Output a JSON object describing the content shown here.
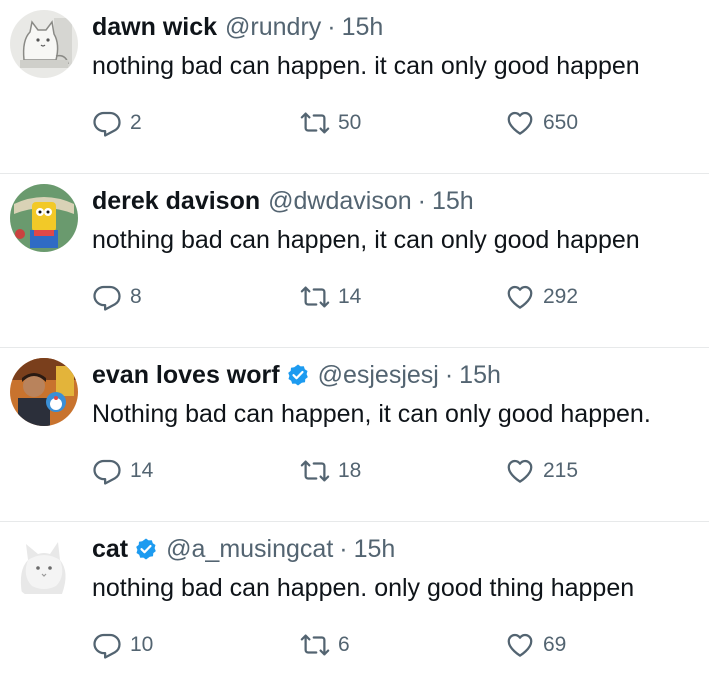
{
  "tweets": [
    {
      "name": "dawn wick",
      "handle": "@rundry",
      "time": "15h",
      "verified": false,
      "text": "nothing bad can happen. it can only good happen",
      "replies": "2",
      "retweets": "50",
      "likes": "650",
      "avatar": "cat-drawing-avatar"
    },
    {
      "name": "derek davison",
      "handle": "@dwdavison",
      "time": "15h",
      "verified": false,
      "text": "nothing bad can happen, it can only good happen",
      "replies": "8",
      "retweets": "14",
      "likes": "292",
      "avatar": "cartoon-avatar"
    },
    {
      "name": "evan loves worf",
      "handle": "@esjesjesj",
      "time": "15h",
      "verified": true,
      "text": "Nothing bad can happen, it can only good happen.",
      "replies": "14",
      "retweets": "18",
      "likes": "215",
      "avatar": "photo-avatar"
    },
    {
      "name": "cat",
      "handle": "@a_musingcat",
      "time": "15h",
      "verified": true,
      "text": "nothing bad can happen. only good thing happen",
      "replies": "10",
      "retweets": "6",
      "likes": "69",
      "avatar": "white-cat-avatar"
    }
  ],
  "separator": "·",
  "colors": {
    "text": "#0f1419",
    "secondary": "#536471",
    "verified": "#1d9bf0",
    "divider": "#e7e9ea"
  }
}
